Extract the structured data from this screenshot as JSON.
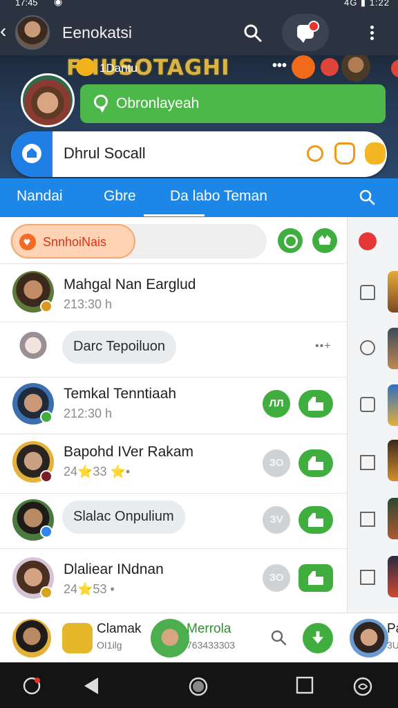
{
  "status_bar": {
    "time": "17:45",
    "right": "4G ▮ 1:22"
  },
  "header": {
    "title": "Eenokatsi"
  },
  "banner": {
    "art_title": "FHUSOTAGHI",
    "sub_label": "1Dantu",
    "cta_label": "Obronlayeah"
  },
  "title_card": {
    "name": "Dhrul Socall"
  },
  "tabs": [
    {
      "label": "Nandai"
    },
    {
      "label": "Gbre"
    },
    {
      "label": "Da labo Teman"
    }
  ],
  "filter": {
    "chip_label": "SnnhoiNais"
  },
  "rows": [
    {
      "name": "Mahgal Nan Earglud",
      "meta": "213:30 h"
    },
    {
      "status_pill": "Darc Tepoiluon",
      "more": "••+"
    },
    {
      "name": "Temkal Tenntiaah",
      "meta": "212:30 h",
      "btn_label": "ЛЛ"
    },
    {
      "name": "Bapohd IVer Rakam",
      "meta": "24⭐33 ⭐•",
      "btn_label": "ЗО"
    },
    {
      "status_pill": "Slalac Onpulium",
      "btn_label": "ЗV"
    },
    {
      "name": "Dlaliear INdnan",
      "meta": "24⭐53 •",
      "btn_label": "ЗО"
    }
  ],
  "bottom": {
    "name1": "Clamak",
    "sub1": "OI1ilg",
    "name2": "Merrola",
    "sub2": "763433303",
    "name3": "Pa",
    "sub3": "3U"
  },
  "colors": {
    "header_bg": "#2c3340",
    "tab_bar": "#1d87e8",
    "accent_green": "#3fae3f",
    "cta_green": "#4cb84a",
    "chip_orange": "#ffd3b4"
  },
  "icons": [
    "back-icon",
    "search-icon",
    "chat-icon",
    "more-icon",
    "home-icon",
    "key-icon",
    "hand-icon",
    "badge-icon",
    "heart-icon",
    "download-icon"
  ]
}
